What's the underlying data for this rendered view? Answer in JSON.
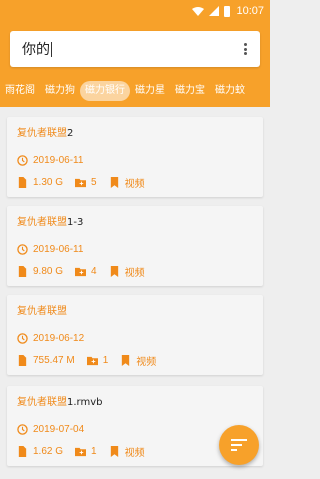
{
  "status_bar": {
    "time": "10:07"
  },
  "search": {
    "query": "你的"
  },
  "tabs": [
    {
      "label": "雨花阁",
      "active": false
    },
    {
      "label": "磁力狗",
      "active": false
    },
    {
      "label": "磁力银行",
      "active": true
    },
    {
      "label": "磁力星",
      "active": false
    },
    {
      "label": "磁力宝",
      "active": false
    },
    {
      "label": "磁力蚊",
      "active": false
    }
  ],
  "results": [
    {
      "title_cn": "复仇者联盟",
      "title_suffix": "2",
      "date": "2019-06-11",
      "size": "1.30 G",
      "files": "5",
      "type": "视频"
    },
    {
      "title_cn": "复仇者联盟",
      "title_suffix": "1-3",
      "date": "2019-06-11",
      "size": "9.80 G",
      "files": "4",
      "type": "视频"
    },
    {
      "title_cn": "复仇者联盟",
      "title_suffix": "",
      "date": "2019-06-12",
      "size": "755.47 M",
      "files": "1",
      "type": "视频"
    },
    {
      "title_cn": "复仇者联盟",
      "title_suffix": "1.rmvb",
      "date": "2019-07-04",
      "size": "1.62 G",
      "files": "1",
      "type": "视频"
    }
  ],
  "colors": {
    "accent": "#f7a12a",
    "text_accent": "#f08a1a",
    "background": "#eeeeee",
    "card": "#f5f5f5"
  },
  "icons": {
    "wifi": "wifi-icon",
    "signal": "signal-icon",
    "battery": "battery-icon",
    "menu": "more-vert-icon",
    "clock": "clock-icon",
    "file": "file-icon",
    "folder": "folder-icon",
    "bookmark": "bookmark-icon",
    "sort": "sort-icon"
  }
}
